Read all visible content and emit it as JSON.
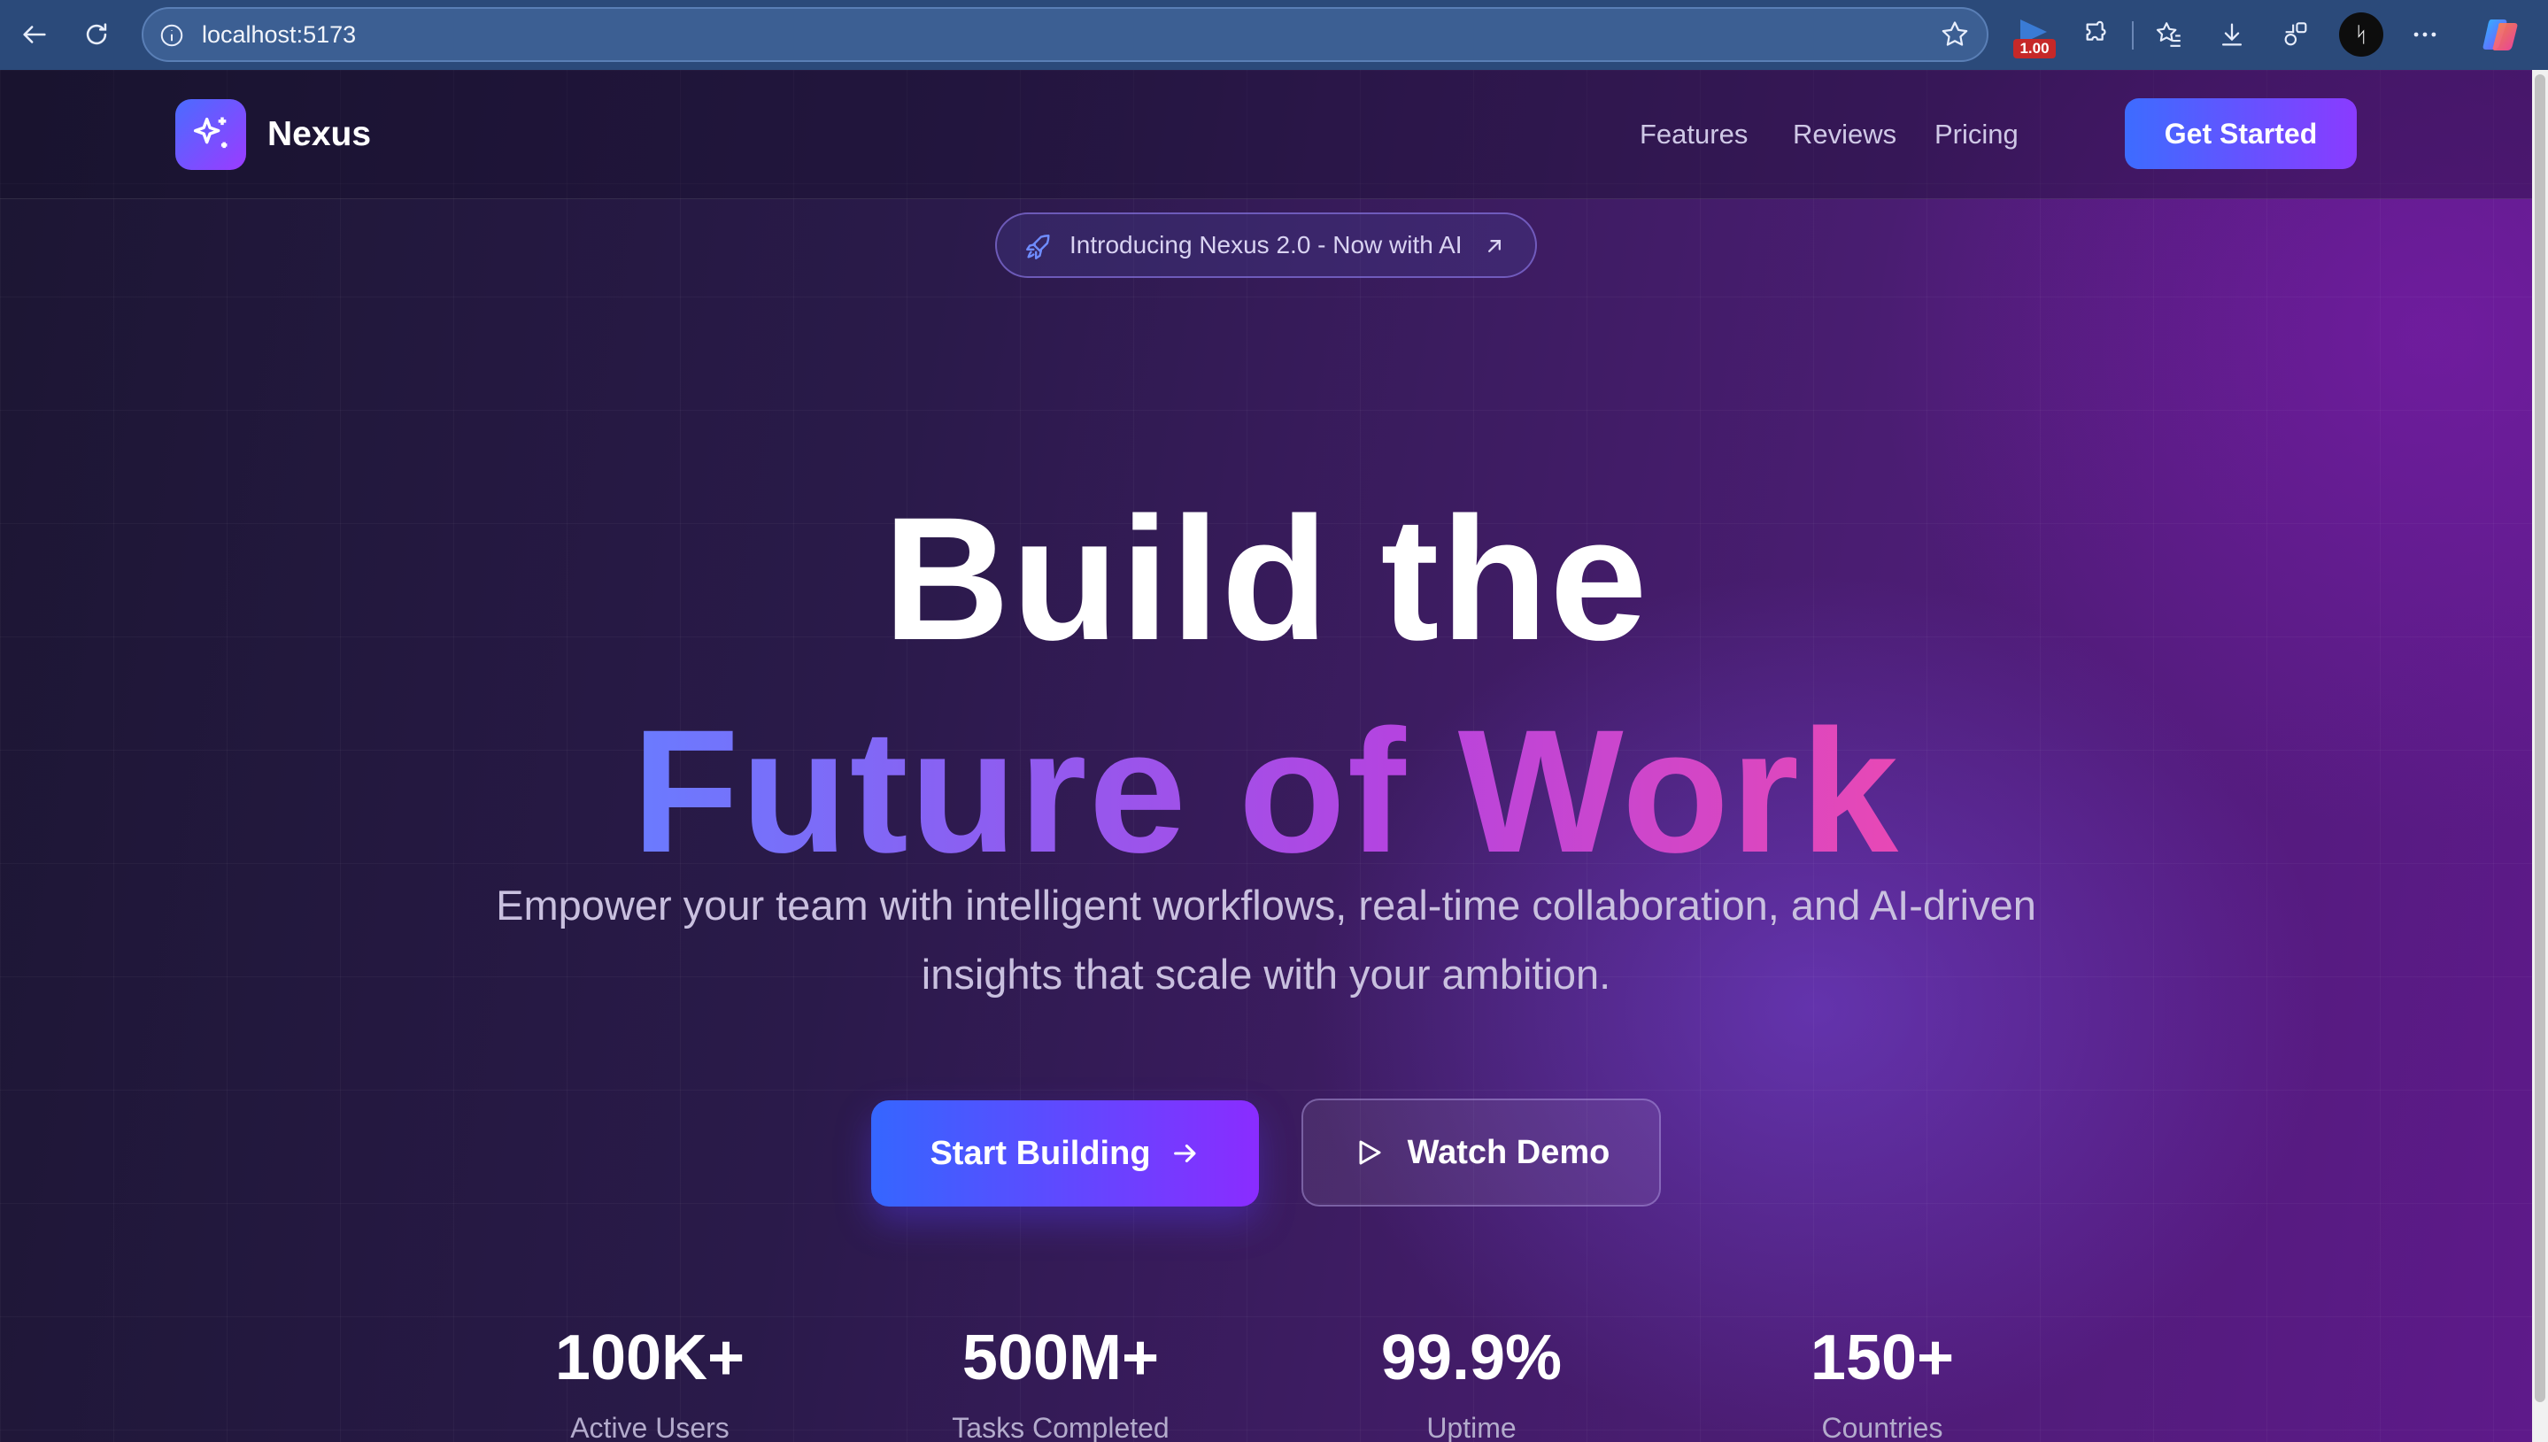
{
  "browser": {
    "url": "localhost:5173",
    "extension_badge": "1.00",
    "profile_initial": "ᛋ",
    "icons": [
      "back-icon",
      "refresh-icon",
      "info-icon",
      "star-icon",
      "extensions-icon",
      "favorites-icon",
      "downloads-icon",
      "collections-icon",
      "more-icon",
      "copilot-icon"
    ]
  },
  "header": {
    "brand": "Nexus",
    "nav": [
      "Features",
      "Reviews",
      "Pricing"
    ],
    "cta": "Get Started"
  },
  "announcement": {
    "text": "Introducing Nexus 2.0 - Now with AI"
  },
  "hero": {
    "line1": "Build the",
    "line2": "Future of Work",
    "subtitle": "Empower your team with intelligent workflows, real-time collaboration, and AI-driven insights that scale with your ambition.",
    "primary_button": "Start Building",
    "secondary_button": "Watch Demo"
  },
  "stats": [
    {
      "value": "100K+",
      "label": "Active Users"
    },
    {
      "value": "500M+",
      "label": "Tasks Completed"
    },
    {
      "value": "99.9%",
      "label": "Uptime"
    },
    {
      "value": "150+",
      "label": "Countries"
    }
  ],
  "colors": {
    "accent_blue": "#3d6cff",
    "accent_purple": "#8a3bff",
    "gradient_pink": "#e848b5",
    "browser_chrome": "#2b4a7a"
  }
}
